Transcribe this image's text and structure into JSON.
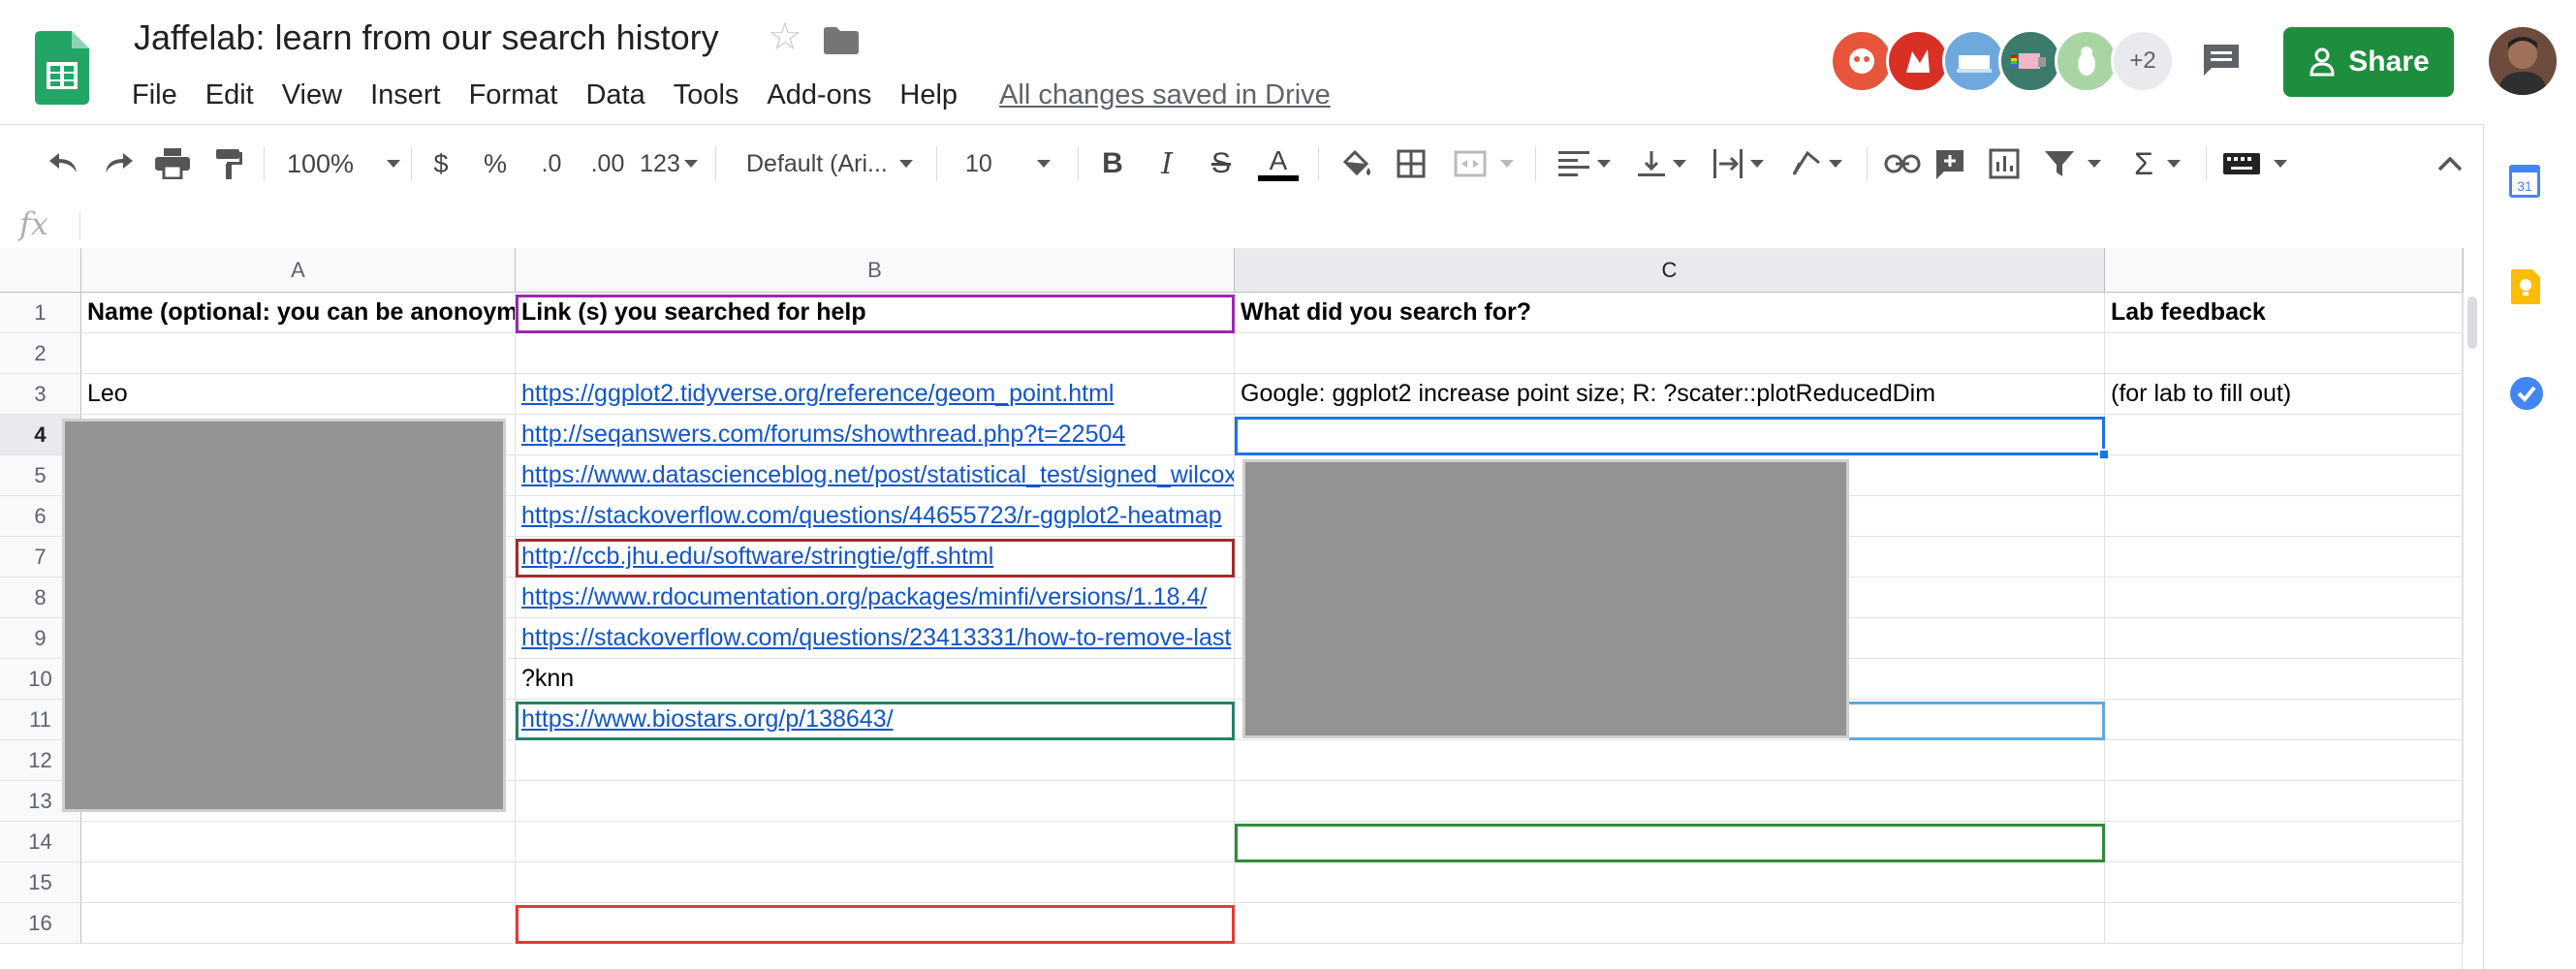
{
  "header": {
    "title": "Jaffelab: learn from our search history",
    "menu": [
      "File",
      "Edit",
      "View",
      "Insert",
      "Format",
      "Data",
      "Tools",
      "Add-ons",
      "Help"
    ],
    "save_status": "All changes saved in Drive",
    "collaborators_more": "+2",
    "share_label": "Share"
  },
  "toolbar": {
    "zoom": "100%",
    "currency": "$",
    "percent": "%",
    "decrease_decimal": ".0",
    "increase_decimal": ".00",
    "more_formats": "123",
    "font": "Default (Ari...",
    "font_size": "10",
    "bold": "B",
    "italic": "I",
    "strikethrough": "S",
    "text_color": "A"
  },
  "formula_bar": {
    "fx": "fx",
    "value": ""
  },
  "grid": {
    "columns": [
      {
        "label": "A",
        "selected": false
      },
      {
        "label": "B",
        "selected": false
      },
      {
        "label": "C",
        "selected": true
      },
      {
        "label": "",
        "selected": false
      }
    ],
    "rows": [
      "1",
      "2",
      "3",
      "4",
      "5",
      "6",
      "7",
      "8",
      "9",
      "10",
      "11",
      "12",
      "13",
      "14",
      "15",
      "16"
    ],
    "selected_row": "4",
    "cells": {
      "A1": "Name (optional: you can be anonoymous)",
      "B1": "Link (s) you searched for help",
      "C1": "What did you search for?",
      "D1": "Lab feedback",
      "A3": "Leo",
      "B3": "https://ggplot2.tidyverse.org/reference/geom_point.html",
      "C3": "Google: ggplot2 increase point size; R: ?scater::plotReducedDim",
      "D3": "(for lab to fill out)",
      "B4": "http://seqanswers.com/forums/showthread.php?t=22504",
      "B5": "https://www.datascienceblog.net/post/statistical_test/signed_wilcox_rank_test/",
      "B6": "https://stackoverflow.com/questions/44655723/r-ggplot2-heatmap",
      "B7": "http://ccb.jhu.edu/software/stringtie/gff.shtml",
      "B8": "https://www.rdocumentation.org/packages/minfi/versions/1.18.4/",
      "B9": "https://stackoverflow.com/questions/23413331/how-to-remove-last",
      "B10": "?knn",
      "B11": "https://www.biostars.org/p/138643/"
    }
  },
  "colors": {
    "share_green": "#1e8e3e",
    "link_blue": "#1155cc",
    "selection_blue": "#1a73e8",
    "cursor_purple": "#9c27b0",
    "cursor_darkred": "#a52a2a",
    "cursor_teal": "#26806a",
    "cursor_lightblue": "#5fa8e0",
    "cursor_green": "#2e8b3a",
    "cursor_red": "#e53935",
    "redaction_gray": "#939393"
  },
  "icons": {
    "sheets_logo": "google-sheets-logo-icon",
    "star": "star-icon",
    "folder": "folder-icon",
    "comments": "comment-icon",
    "share_lock": "person-lock-icon"
  }
}
